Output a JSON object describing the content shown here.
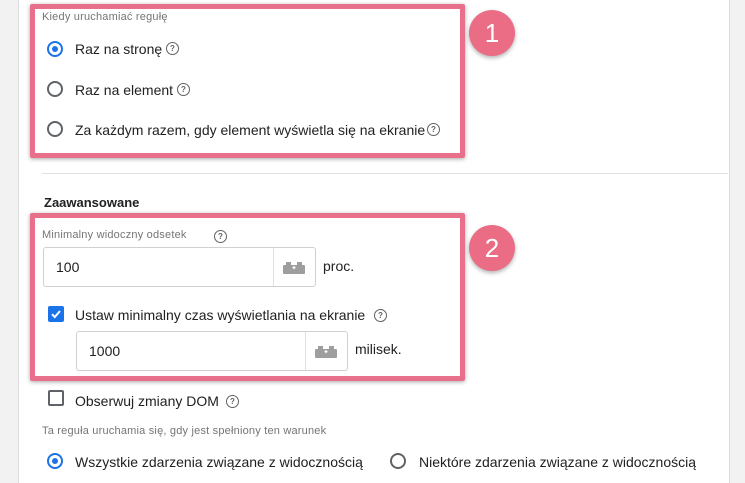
{
  "trigger_frequency": {
    "label": "Kiedy uruchamiać regułę",
    "options": [
      {
        "label": "Raz na stronę",
        "selected": true
      },
      {
        "label": "Raz na element",
        "selected": false
      },
      {
        "label": "Za każdym razem, gdy element wyświetla się na ekranie",
        "selected": false
      }
    ]
  },
  "advanced": {
    "title": "Zaawansowane",
    "min_visible_percent": {
      "label": "Minimalny widoczny odsetek",
      "value": "100",
      "unit": "proc."
    },
    "min_duration": {
      "label": "Ustaw minimalny czas wyświetlania na ekranie",
      "checked": true,
      "value": "1000",
      "unit": "milisek."
    },
    "observe_dom": {
      "label": "Obserwuj zmiany DOM",
      "checked": false
    }
  },
  "condition": {
    "label": "Ta reguła uruchamia się, gdy jest spełniony ten warunek",
    "options": [
      {
        "label": "Wszystkie zdarzenia związane z widocznością",
        "selected": true
      },
      {
        "label": "Niektóre zdarzenia związane z widocznością",
        "selected": false
      }
    ]
  },
  "annotations": {
    "badge_1": "1",
    "badge_2": "2",
    "highlight_color": "#e8708a"
  },
  "colors": {
    "accent": "#1a73e8"
  }
}
